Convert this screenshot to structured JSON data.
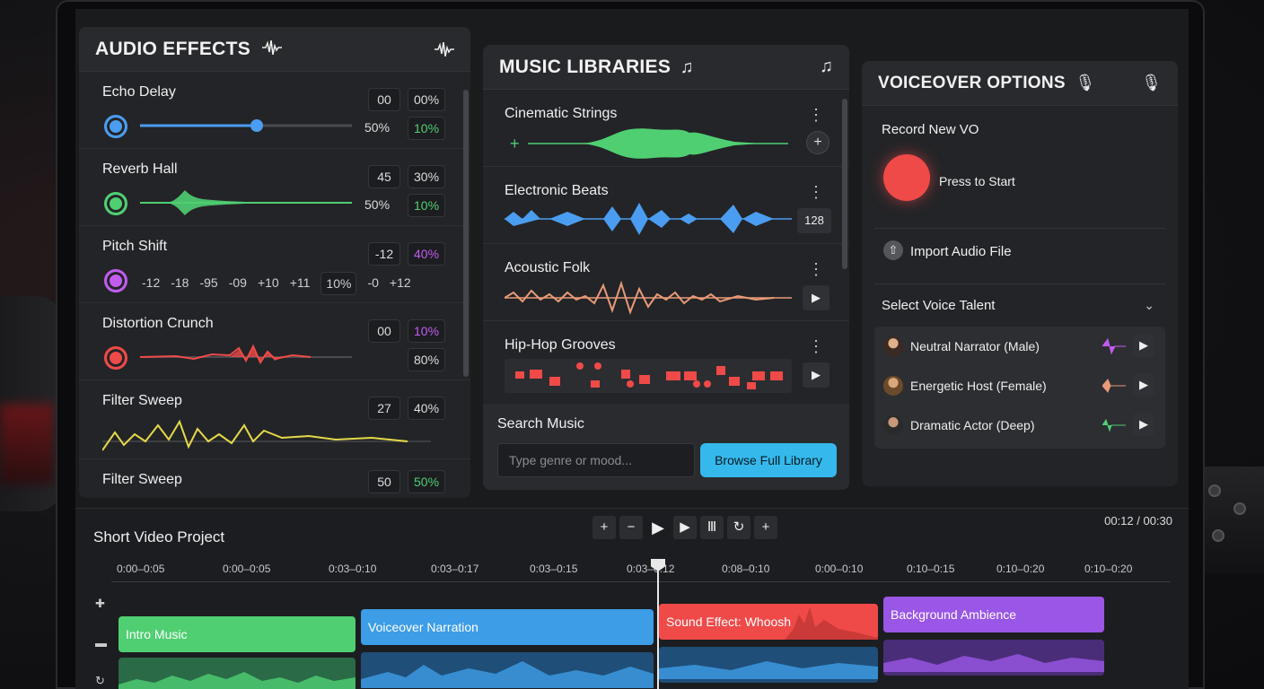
{
  "colors": {
    "blue": "#4a9df0",
    "green": "#4fcf72",
    "purple": "#c25cf0",
    "red": "#ef4a48",
    "yellow": "#e5d94a",
    "cyan": "#35b9ec",
    "orange": "#e89a78"
  },
  "fx": {
    "title": "AUDIO EFFECTS",
    "icon": "waveform-icon",
    "rows": [
      {
        "name": "Echo Delay",
        "v1": "00",
        "v2": "00%",
        "v3": "50%",
        "v4": "10%",
        "slider_level": 0.55
      },
      {
        "name": "Reverb Hall",
        "v1": "45",
        "v2": "30%",
        "v3": "50%",
        "v4": "10%"
      },
      {
        "name": "Pitch Shift",
        "v1": "-12",
        "v2": "40%",
        "ticks": [
          "-12",
          "-18",
          "-95",
          "-09",
          "+10",
          "+11",
          "10%",
          "-0",
          "+12"
        ]
      },
      {
        "name": "Distortion Crunch",
        "v1": "00",
        "v2": "10%",
        "v3": "80%"
      },
      {
        "name": "Filter Sweep",
        "v1": "27",
        "v2": "40%"
      },
      {
        "name": "Filter Sweep",
        "v1": "50",
        "v2": "50%"
      }
    ]
  },
  "music": {
    "title": "MUSIC LIBRARIES",
    "icon": "music-note-icon",
    "tracks": [
      {
        "name": "Cinematic Strings"
      },
      {
        "name": "Electronic Beats",
        "bpm": "128"
      },
      {
        "name": "Acoustic Folk"
      },
      {
        "name": "Hip-Hop Grooves"
      }
    ],
    "search_label": "Search Music",
    "search_placeholder": "Type genre or mood...",
    "browse_label": "Browse Full Library"
  },
  "vo": {
    "title": "VOICEOVER OPTIONS",
    "icon": "microphone-icon",
    "record_label": "Record New VO",
    "press_label": "Press to Start",
    "import_label": "Import Audio File",
    "select_label": "Select Voice Talent",
    "talents": [
      {
        "name": "Neutral Narrator (Male)",
        "wave_color": "#c25cf0"
      },
      {
        "name": "Energetic Host (Female)",
        "wave_color": "#e89a78"
      },
      {
        "name": "Dramatic Actor (Deep)",
        "wave_color": "#4fcf72"
      }
    ]
  },
  "timeline": {
    "project_title": "Short Video Project",
    "timecode": "00:12 / 00:30",
    "ruler_labels": [
      "0:00–0:05",
      "0:00–0:05",
      "0:03–0:10",
      "0:03–0:17",
      "0:03–0:15",
      "0:03–0:12",
      "0:08–0:10",
      "0:00–0:10",
      "0:10–0:15",
      "0:10–0:20",
      "0:10–0:20"
    ],
    "clips": [
      {
        "label": "Intro Music",
        "color": "#4fcf72"
      },
      {
        "label": "Voiceover Narration",
        "color": "#3d9de6"
      },
      {
        "label": "Sound Effect: Whoosh",
        "color": "#ef4a48"
      },
      {
        "label": "Background Ambience",
        "color": "#9a56e6"
      }
    ]
  }
}
